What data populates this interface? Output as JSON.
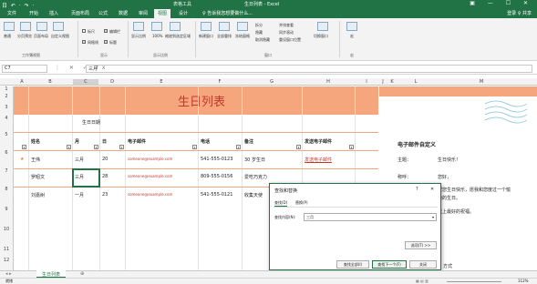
{
  "titlebar": {
    "quick_access": "日 ↶ · ↷ ·",
    "context_tab": "表格工具",
    "window_title": "生日列表 - Excel",
    "window_controls": "▣ — ☐ ✕"
  },
  "tabs": [
    "文件",
    "开始",
    "插入",
    "页面布局",
    "公式",
    "数据",
    "审阅",
    "视图",
    "设计"
  ],
  "tell_me": "♀ 告诉我您想要做什么...",
  "account": "登录  ♀ 共享",
  "ribbon": {
    "views": [
      "普通",
      "分页预览",
      "页面布局",
      "自定义视图"
    ],
    "show": {
      "ruler": "标尺",
      "gridlines": "网格线",
      "formula_bar": "编辑栏",
      "headings": "标题"
    },
    "zoom": [
      "显示比例",
      "100%",
      "缩放到选定区域"
    ],
    "window": [
      "新建窗口",
      "全部重排",
      "冻结窗格",
      "拆分",
      "隐藏",
      "取消隐藏",
      "并排查看",
      "同步滚动",
      "重设窗口位置",
      "切换窗口"
    ],
    "macros": "宏",
    "groups": [
      "工作簿视图",
      "显示",
      "显示比例",
      "窗口",
      "宏"
    ]
  },
  "formula_bar": {
    "name_box": "C7",
    "fx_icons": "⋮  ✕  ✓  fx",
    "value": "三月"
  },
  "columns": [
    "A",
    "B",
    "C",
    "D",
    "E",
    "F",
    "G",
    "H",
    "I",
    "J",
    "K",
    "L",
    "M"
  ],
  "rows": [
    "1",
    "2",
    "3",
    "4",
    "5",
    "6",
    "7",
    "8",
    "9",
    "10",
    "11",
    "12"
  ],
  "sheet_title": "生日列表",
  "birthday_group": "生日日期",
  "headers": [
    "姓名",
    "月",
    "日",
    "电子邮件",
    "电话",
    "备注",
    "发送电子邮件"
  ],
  "records": [
    {
      "star": "★",
      "name": "王伟",
      "month": "三月",
      "day": "20",
      "email": "someone@example.com",
      "phone": "541-555-0123",
      "note": "30 岁生日",
      "send": "发送电子邮件"
    },
    {
      "star": "",
      "name": "罗昭文",
      "month": "三月",
      "day": "28",
      "email": "someone@example.com",
      "phone": "809-555-0156",
      "note": "爱吃巧克力",
      "send": ""
    },
    {
      "star": "",
      "name": "刘嘉树",
      "month": "一月",
      "day": "23",
      "email": "someone@example.com",
      "phone": "541-555-0121",
      "note": "收集天使",
      "send": ""
    }
  ],
  "side_panel": {
    "title": "电子邮件自定义",
    "subject_label": "主题：",
    "subject_value": "生日快乐！",
    "greeting_label": "称呼：",
    "greeting_value": "您好，",
    "body_lines": [
      "祝您生日快乐，愿我和您度过一个愉",
      "快的生日。",
      "送上最好的祝福。"
    ],
    "footer": "方式"
  },
  "dialog": {
    "title": "查找和替换",
    "help": "?",
    "close": "✕",
    "tab_find": "查找(D)",
    "tab_replace": "替换(P)",
    "find_label": "查找内容(N):",
    "find_value": "三月",
    "options_btn": "选项(T) >>",
    "find_all_btn": "查找全部(I)",
    "find_next_btn": "查找下一个(F)",
    "close_btn": "关闭"
  },
  "sheet_tabs": {
    "active": "生日列表",
    "add": "⊕"
  },
  "status": {
    "left": "就绪",
    "zoom": "112%"
  }
}
